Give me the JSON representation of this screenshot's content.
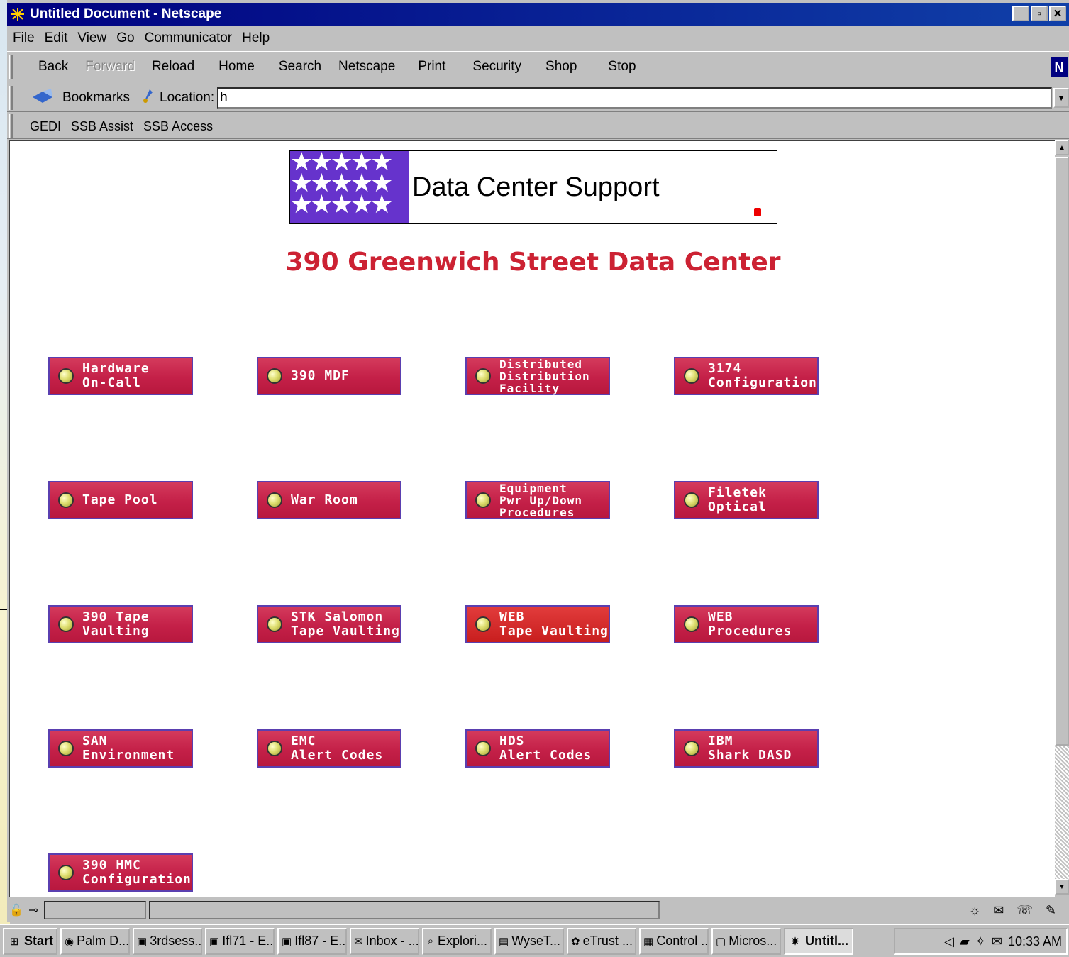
{
  "window": {
    "title": "Untitled Document - Netscape"
  },
  "menu": [
    "File",
    "Edit",
    "View",
    "Go",
    "Communicator",
    "Help"
  ],
  "toolbar": {
    "back": "Back",
    "forward": "Forward",
    "reload": "Reload",
    "home": "Home",
    "search": "Search",
    "netscape": "Netscape",
    "print": "Print",
    "security": "Security",
    "shop": "Shop",
    "stop": "Stop"
  },
  "location": {
    "bookmarks_label": "Bookmarks",
    "location_label": "Location:",
    "url": "h"
  },
  "personal": [
    "GEDI",
    "SSB Assist",
    "SSB Access"
  ],
  "page": {
    "banner_title": "Data Center Support",
    "heading": "390 Greenwich Street Data Center",
    "buttons": [
      "Hardware\nOn-Call",
      "390 MDF",
      "Distributed\nDistribution\nFacility",
      "3174\nConfiguration",
      "Tape Pool",
      "War Room",
      "Equipment\nPwr Up/Down\nProcedures",
      "Filetek\nOptical",
      "390 Tape\nVaulting",
      "STK Salomon\nTape Vaulting",
      "WEB\nTape Vaulting",
      "WEB\nProcedures",
      "SAN\nEnvironment",
      "EMC\nAlert Codes",
      "HDS\nAlert Codes",
      "IBM\nShark DASD",
      "390 HMC\nConfiguration"
    ]
  },
  "taskbar": {
    "start": "Start",
    "tasks": [
      "Palm D...",
      "3rdsess...",
      "Ifl71 - E...",
      "Ifl87 - E...",
      "Inbox - ...",
      "Explori...",
      "WyseT...",
      "eTrust ...",
      "Control ...",
      "Micros...",
      "Untitl..."
    ],
    "clock": "10:33 AM"
  },
  "colors": {
    "title_bar": "#000080",
    "heading": "#cc2233",
    "button": "#c42048"
  }
}
